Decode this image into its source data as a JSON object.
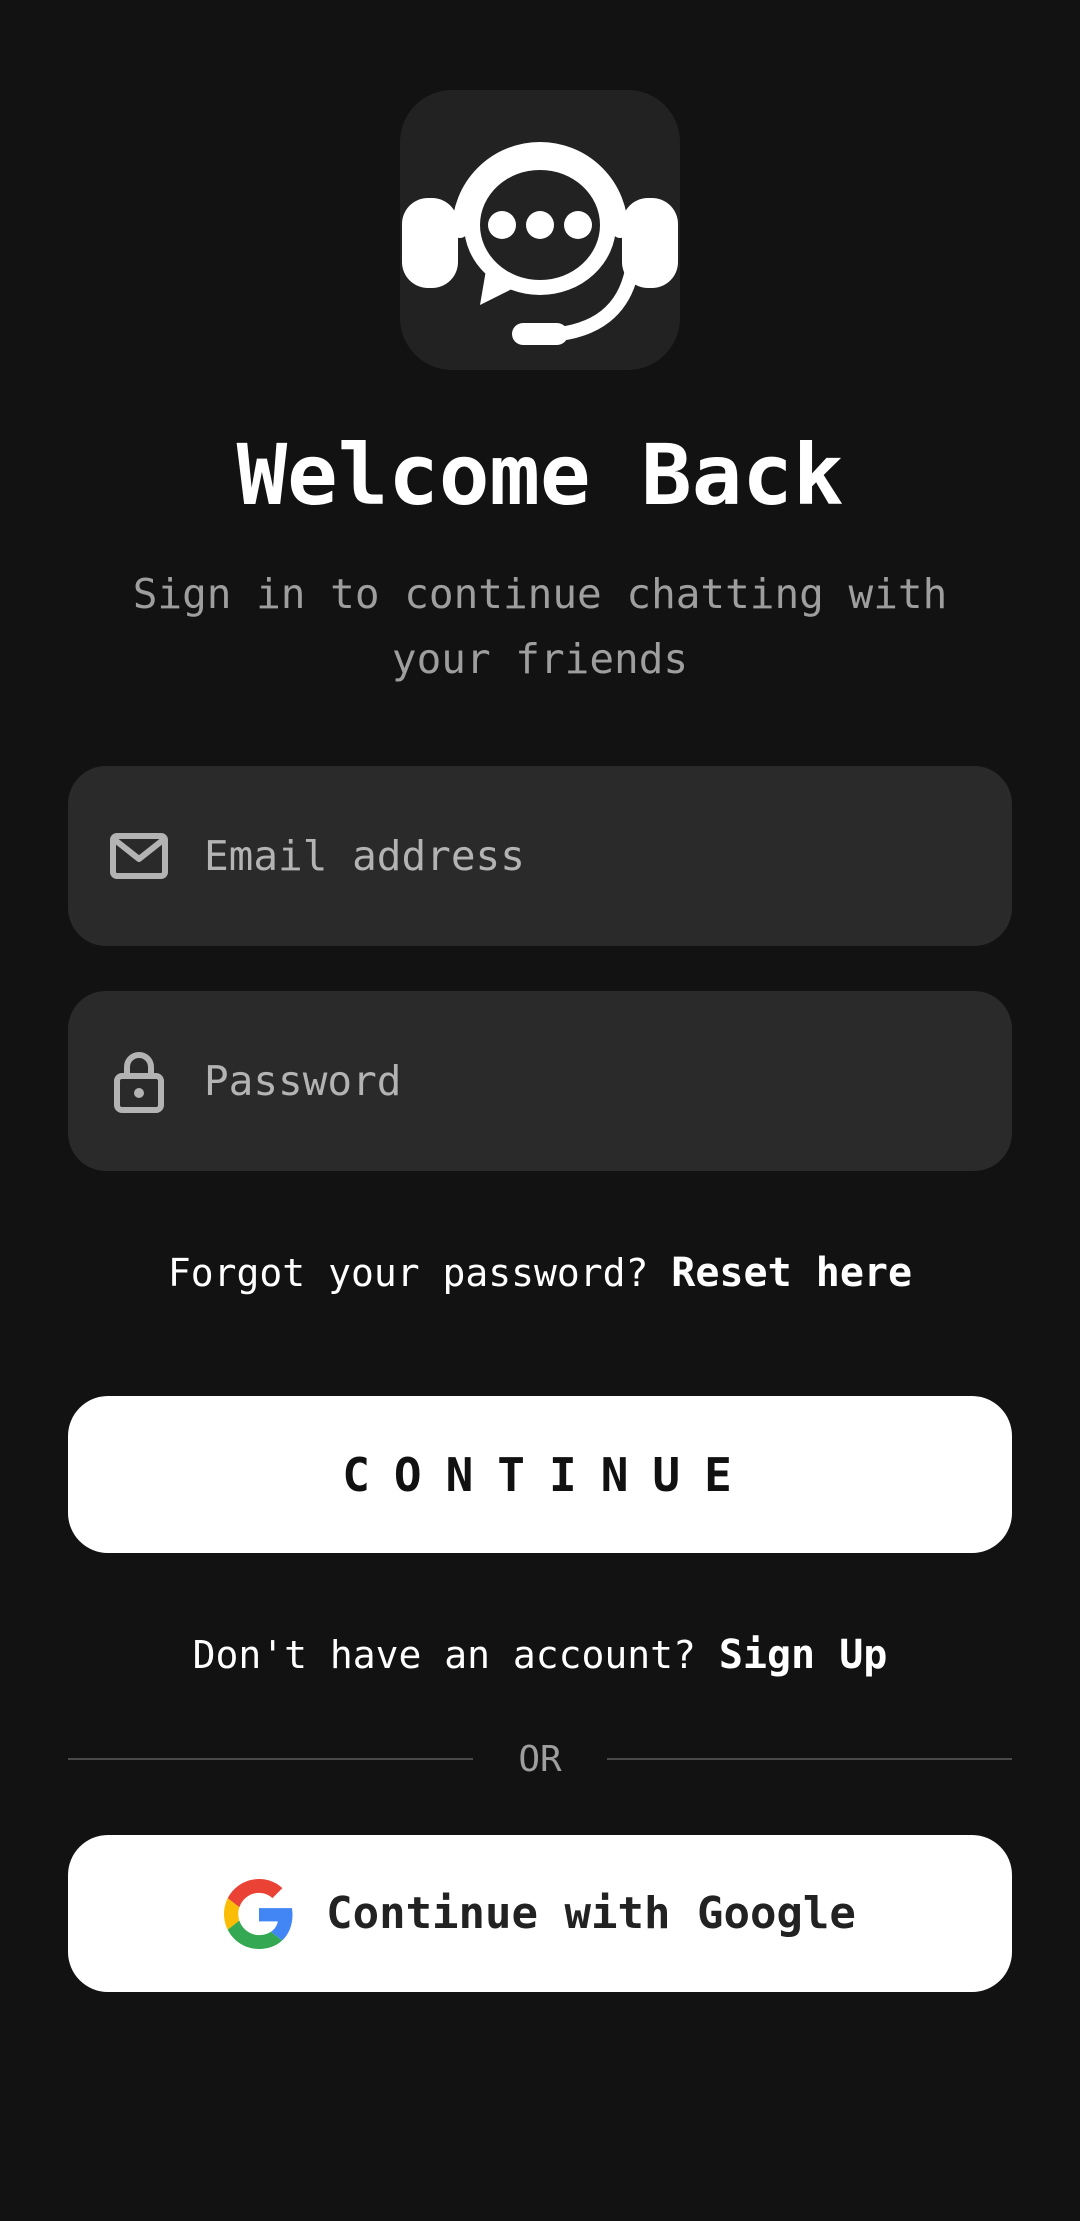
{
  "header": {
    "logo_icon": "headset-chat-icon",
    "title": "Welcome Back",
    "subtitle": "Sign in to continue chatting with your friends"
  },
  "form": {
    "email": {
      "icon": "mail-icon",
      "placeholder": "Email address",
      "value": ""
    },
    "password": {
      "icon": "lock-icon",
      "placeholder": "Password",
      "value": ""
    }
  },
  "forgot": {
    "prefix": "Forgot your password? ",
    "link": "Reset here"
  },
  "continue_label": "CONTINUE",
  "signup": {
    "prefix": "Don't have an account? ",
    "link": "Sign Up"
  },
  "divider_label": "OR",
  "google": {
    "icon": "google-icon",
    "label": "Continue with Google"
  },
  "colors": {
    "background": "#121212",
    "field": "#2a2a2a",
    "button": "#ffffff",
    "muted": "#9e9e9e"
  }
}
